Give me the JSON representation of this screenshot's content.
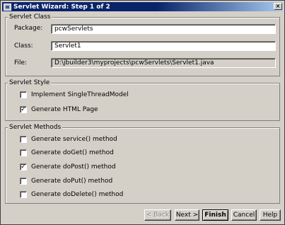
{
  "window": {
    "title": "Servlet Wizard: Step 1 of 2",
    "close_label": "×"
  },
  "servlet_class": {
    "group_title": "Servlet Class",
    "package_label": "Package:",
    "package_value": "pcwServlets",
    "class_label": "Class:",
    "class_value": "Servlet1",
    "file_label": "File:",
    "file_value": "D:\\jbuilder3\\myprojects\\pcwServlets\\Servlet1.java"
  },
  "servlet_style": {
    "group_title": "Servlet Style",
    "options": [
      {
        "label": "Implement SingleThreadModel",
        "checked": false
      },
      {
        "label": "Generate HTML Page",
        "checked": true
      }
    ]
  },
  "servlet_methods": {
    "group_title": "Servlet Methods",
    "options": [
      {
        "label": "Generate service() method",
        "checked": false
      },
      {
        "label": "Generate doGet() method",
        "checked": false
      },
      {
        "label": "Generate doPost() method",
        "checked": true
      },
      {
        "label": "Generate doPut() method",
        "checked": false
      },
      {
        "label": "Generate doDelete() method",
        "checked": false
      }
    ]
  },
  "buttons": {
    "back": "< Back",
    "next": "Next >",
    "finish": "Finish",
    "cancel": "Cancel",
    "help": "Help"
  }
}
